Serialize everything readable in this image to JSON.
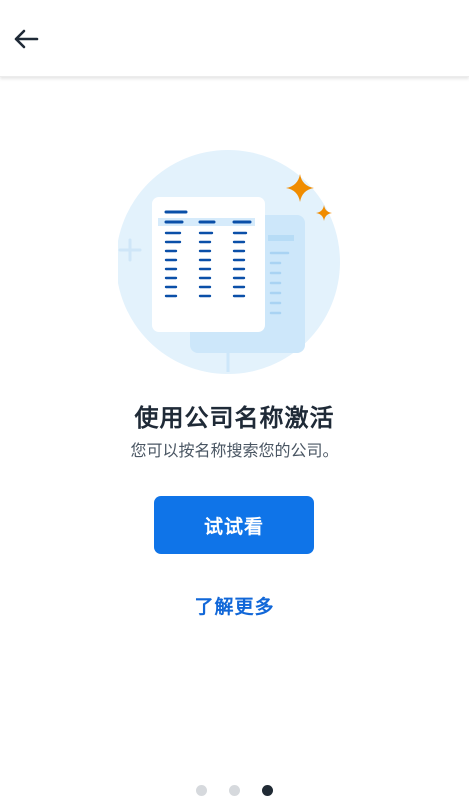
{
  "header": {
    "back_icon": "arrow-left-icon"
  },
  "illustration": {
    "icon": "document-table-illustration",
    "accent_color": "#f08c00",
    "primary_color": "#0a4fa8",
    "circle_color": "#e3f2fc"
  },
  "content": {
    "title": "使用公司名称激活",
    "subtitle": "您可以按名称搜索您的公司。",
    "primary_button": "试试看",
    "link": "了解更多"
  },
  "pager": {
    "total": 3,
    "active_index": 3
  },
  "colors": {
    "button_bg": "#0f74e8",
    "link": "#1167d8",
    "title": "#1f2a37",
    "active_dot": "#202a34",
    "inactive_dot": "#d6d9dd"
  }
}
